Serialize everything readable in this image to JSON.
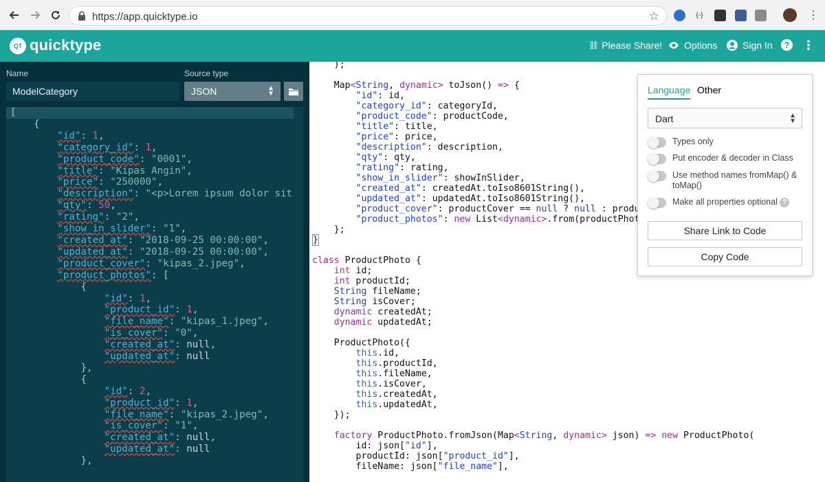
{
  "browser": {
    "url": "https://app.quicktype.io"
  },
  "header": {
    "logo_mark": "QT",
    "title": "quicktype",
    "share_label": "Please Share!",
    "options_label": "Options",
    "signin_label": "Sign In"
  },
  "sidebar": {
    "name_label": "Name",
    "name_value": "ModelCategory",
    "source_type_label": "Source type",
    "source_type_value": "JSON"
  },
  "options": {
    "tabs": [
      "Language",
      "Other"
    ],
    "language_value": "Dart",
    "toggles": [
      {
        "label": "Types only",
        "on": false
      },
      {
        "label": "Put encoder & decoder in Class",
        "on": false
      },
      {
        "label": "Use method names fromMap() & toMap()",
        "on": false
      },
      {
        "label": "Make all properties optional",
        "on": false,
        "help": "?"
      }
    ],
    "share_link_label": "Share Link to Code",
    "copy_code_label": "Copy Code"
  },
  "colors": {
    "brand": "#1ca69b",
    "editor_bg": "#07303d"
  }
}
